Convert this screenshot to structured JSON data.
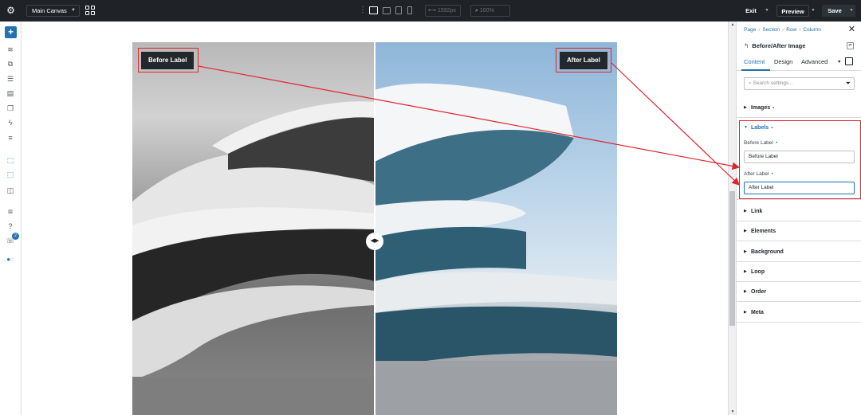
{
  "topbar": {
    "canvas_select": "Main Canvas",
    "width_value": "1592px",
    "zoom_value": "100%",
    "exit_label": "Exit",
    "preview_label": "Preview",
    "save_label": "Save"
  },
  "left_sidebar": {
    "notification_count": "2"
  },
  "canvas": {
    "before_label": "Before Label",
    "after_label": "After Label"
  },
  "panel": {
    "breadcrumbs": [
      "Page",
      "Section",
      "Row",
      "Column"
    ],
    "module_title": "Before/After Image",
    "tabs": [
      "Content",
      "Design",
      "Advanced"
    ],
    "search_placeholder": "Search settings...",
    "sections": {
      "images": "Images",
      "labels": "Labels",
      "link": "Link",
      "elements": "Elements",
      "background": "Background",
      "loop": "Loop",
      "order": "Order",
      "meta": "Meta"
    },
    "fields": {
      "before_label_title": "Before Label",
      "before_label_value": "Before Label",
      "after_label_title": "After Label",
      "after_label_value": "After Label"
    }
  },
  "colors": {
    "accent": "#2271b1",
    "highlight": "#e0242d",
    "topbar_bg": "#1f2328",
    "save_bg": "#2c3338"
  }
}
